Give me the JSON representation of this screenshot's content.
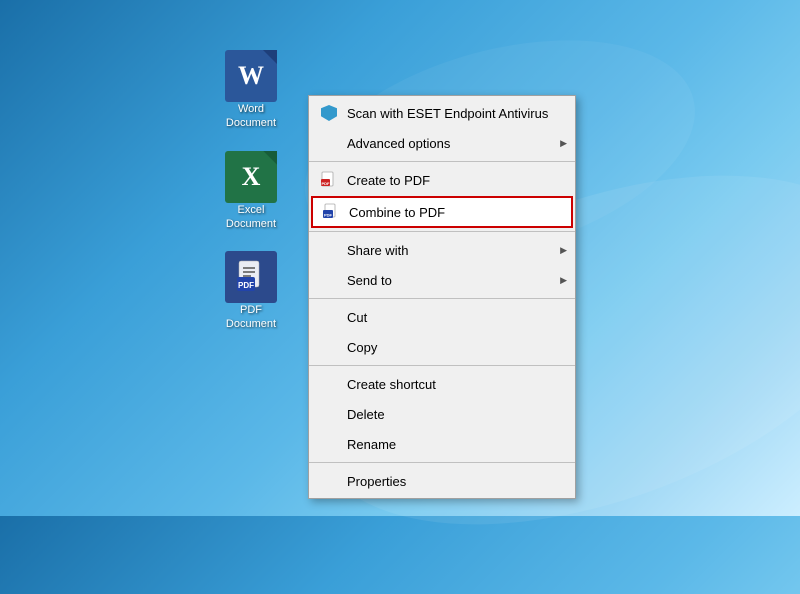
{
  "background": {
    "color_start": "#1a6fa8",
    "color_end": "#cceeff"
  },
  "desktop": {
    "icons": [
      {
        "id": "word",
        "label": "Word\nDocument",
        "letter": "W",
        "color": "#2b579a"
      },
      {
        "id": "excel",
        "label": "Excel\nDocument",
        "letter": "X",
        "color": "#217346"
      },
      {
        "id": "pdf",
        "label": "PDF\nDocument",
        "letter": "",
        "color": "#2c4a8c"
      }
    ]
  },
  "context_menu": {
    "items": [
      {
        "id": "scan-eset",
        "text": "Scan with ESET Endpoint Antivirus",
        "has_icon": true,
        "icon_type": "eset",
        "has_submenu": false,
        "separator_after": false
      },
      {
        "id": "advanced-options",
        "text": "Advanced options",
        "has_icon": false,
        "has_submenu": true,
        "separator_after": true
      },
      {
        "id": "create-pdf",
        "text": "Create to PDF",
        "has_icon": true,
        "icon_type": "pdf",
        "has_submenu": false,
        "separator_after": false
      },
      {
        "id": "combine-pdf",
        "text": "Combine to PDF",
        "has_icon": true,
        "icon_type": "combine",
        "has_submenu": false,
        "highlighted": true,
        "separator_after": true
      },
      {
        "id": "share-with",
        "text": "Share with",
        "has_icon": false,
        "has_submenu": true,
        "separator_after": false
      },
      {
        "id": "send-to",
        "text": "Send to",
        "has_icon": false,
        "has_submenu": true,
        "separator_after": true
      },
      {
        "id": "cut",
        "text": "Cut",
        "has_icon": false,
        "has_submenu": false,
        "separator_after": false
      },
      {
        "id": "copy",
        "text": "Copy",
        "has_icon": false,
        "has_submenu": false,
        "separator_after": true
      },
      {
        "id": "create-shortcut",
        "text": "Create shortcut",
        "has_icon": false,
        "has_submenu": false,
        "separator_after": false
      },
      {
        "id": "delete",
        "text": "Delete",
        "has_icon": false,
        "has_submenu": false,
        "separator_after": false
      },
      {
        "id": "rename",
        "text": "Rename",
        "has_icon": false,
        "has_submenu": false,
        "separator_after": true
      },
      {
        "id": "properties",
        "text": "Properties",
        "has_icon": false,
        "has_submenu": false,
        "separator_after": false
      }
    ]
  }
}
